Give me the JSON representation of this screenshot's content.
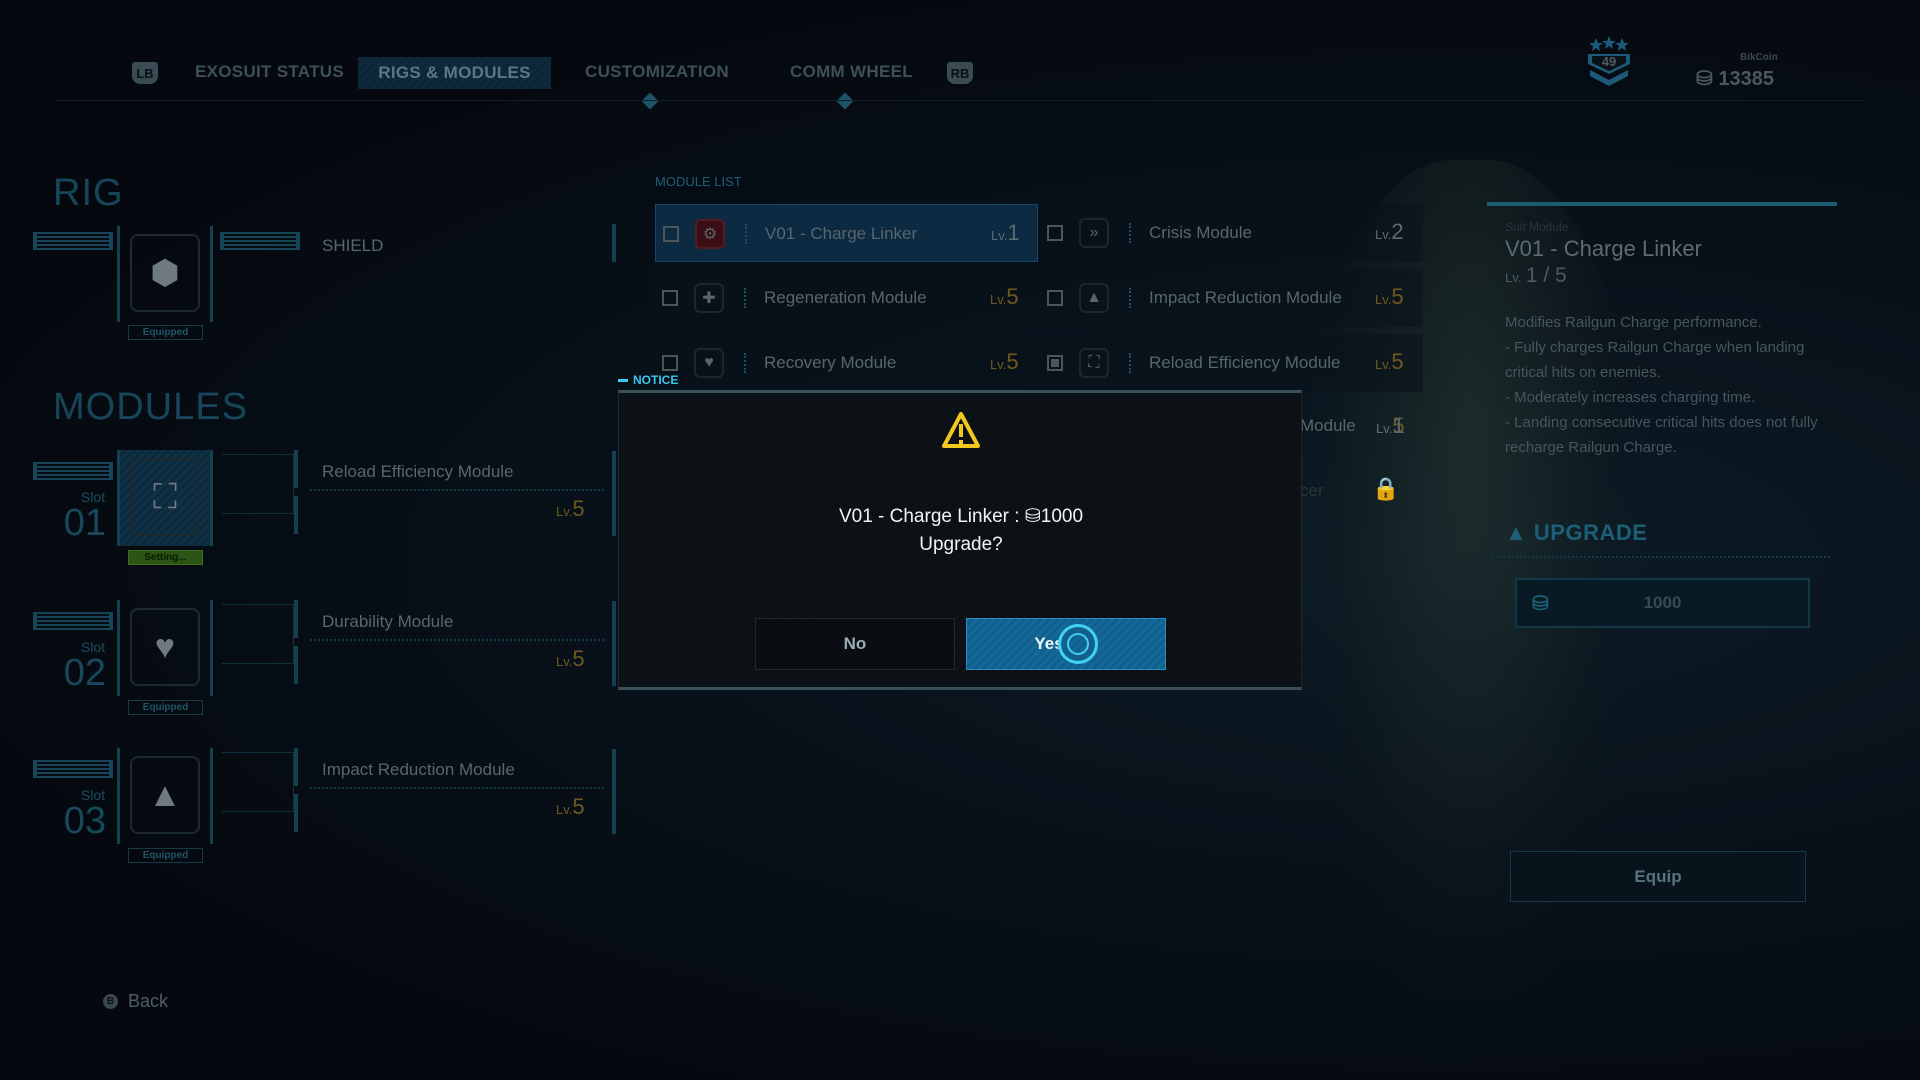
{
  "colors": {
    "accent": "#3ec6f0",
    "selected": "#136a9a",
    "level": "#6e5a1f",
    "warning": "#f2c81e",
    "setting": "#2c5414"
  },
  "tabs": {
    "lb": "LB",
    "rb": "RB",
    "items": [
      {
        "label": "EXOSUIT STATUS"
      },
      {
        "label": "RIGS & MODULES",
        "active": true
      },
      {
        "label": "CUSTOMIZATION",
        "alert": true
      },
      {
        "label": "COMM WHEEL",
        "alert": true
      }
    ]
  },
  "header": {
    "rank": "49",
    "currency_label": "BikCoin",
    "currency_value": "13385"
  },
  "rig": {
    "title": "RIG",
    "name": "SHIELD",
    "status": "Equipped"
  },
  "modules": {
    "title": "MODULES",
    "slots": [
      {
        "slot_label": "Slot",
        "slot_num": "01",
        "name": "Reload Efficiency Module",
        "lv_label": "Lv.",
        "lv": "5",
        "status": "Setting...",
        "icon": "ammo-icon"
      },
      {
        "slot_label": "Slot",
        "slot_num": "02",
        "name": "Durability Module",
        "lv_label": "Lv.",
        "lv": "5",
        "status": "Equipped",
        "icon": "heart-icon"
      },
      {
        "slot_label": "Slot",
        "slot_num": "03",
        "name": "Impact Reduction Module",
        "lv_label": "Lv.",
        "lv": "5",
        "status": "Equipped",
        "icon": "shield-icon"
      }
    ]
  },
  "module_list": {
    "title": "MODULE LIST",
    "items": [
      {
        "name": "V01 - Charge Linker",
        "lv": "1",
        "selected": true,
        "icon": "gear-burst-icon"
      },
      {
        "name": "Crisis Module",
        "lv": "2",
        "icon": "sprint-icon"
      },
      {
        "name": "Regeneration Module",
        "lv": "5",
        "icon": "medical-cross-icon"
      },
      {
        "name": "Impact Reduction Module",
        "lv": "5",
        "icon": "shield-icon"
      },
      {
        "name": "Recovery Module",
        "lv": "5",
        "icon": "heart-icon"
      },
      {
        "name": "Reload Efficiency Module",
        "lv": "5",
        "checked": true,
        "icon": "ammo-icon"
      },
      {
        "name": "Module",
        "lv": "5"
      },
      {
        "name": "",
        "lv": "1"
      },
      {
        "name": "cer",
        "locked": true
      }
    ],
    "lv_label": "Lv."
  },
  "dialog": {
    "title": "NOTICE",
    "line1": "V01 - Charge Linker :",
    "cost": "1000",
    "line2": "Upgrade?",
    "no": "No",
    "yes": "Yes"
  },
  "detail": {
    "category": "Suit Module",
    "name": "V01 - Charge Linker",
    "lv_label": "Lv.",
    "level": "1 / 5",
    "description": [
      "Modifies Railgun Charge performance.",
      "- Fully charges Railgun Charge when landing critical hits on enemies.",
      "- Moderately increases charging time.",
      "- Landing consecutive critical hits does not fully recharge Railgun Charge."
    ],
    "upgrade_label": "UPGRADE",
    "upgrade_cost": "1000",
    "equip": "Equip"
  },
  "footer": {
    "back_key": "B",
    "back": "Back"
  }
}
